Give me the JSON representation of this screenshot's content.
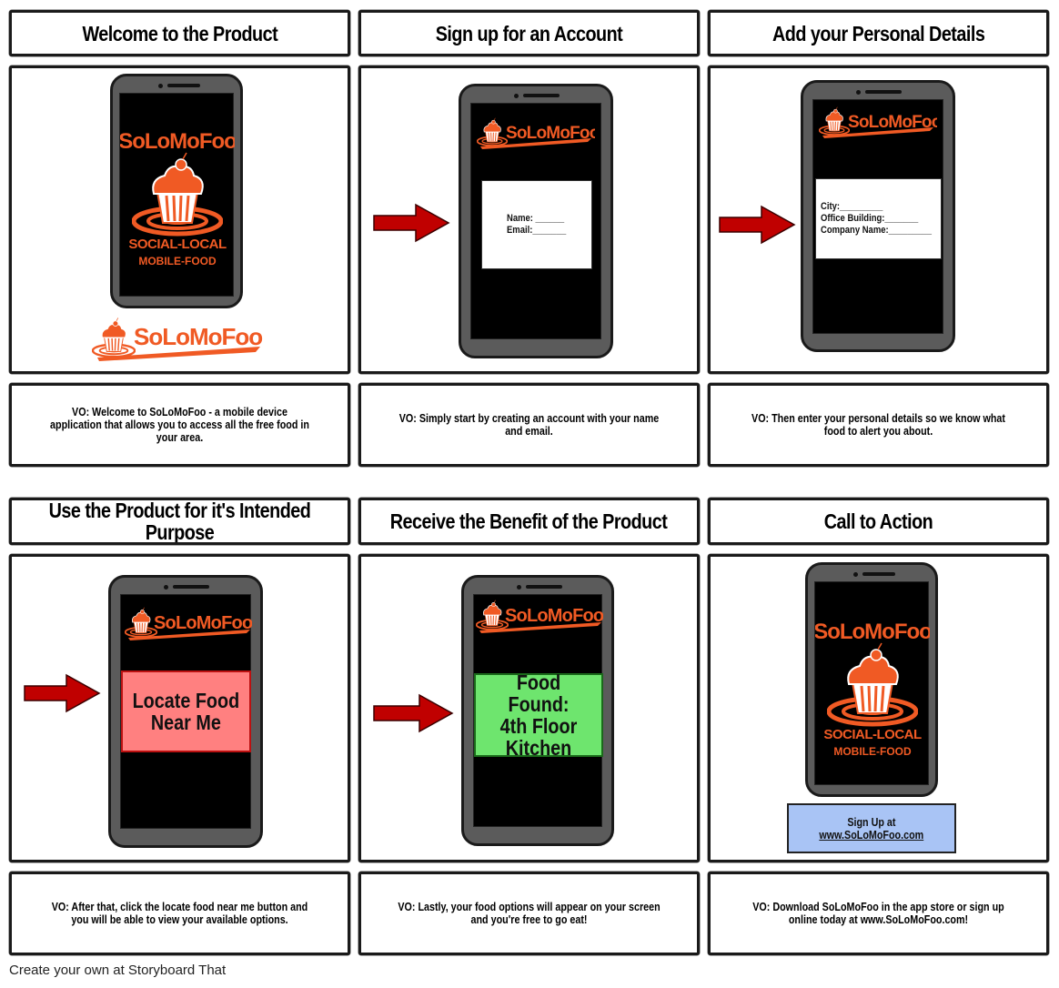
{
  "colors": {
    "brand_orange": "#f05a24",
    "arrow_red": "#c00000",
    "locate_button_fill": "#ff8080",
    "found_fill": "#6ee56e",
    "signup_fill": "#a9c4f5",
    "phone_body": "#5b5b5b"
  },
  "brand": {
    "name": "SoLoMoFoo",
    "tagline_1": "SOCIAL-LOCAL",
    "tagline_2": "MOBILE-FOOD"
  },
  "panels": [
    {
      "title": "Welcome to the Product",
      "caption": "VO: Welcome to SoLoMoFoo - a mobile device application that allows you to access all the free food in your area.",
      "scene": {
        "type": "splash",
        "icons": [
          "phone-icon",
          "cupcake-logo-icon",
          "solomofoo-wordmark-icon"
        ]
      }
    },
    {
      "title": "Sign up for an Account",
      "caption": "VO: Simply start by creating an account with your name and email.",
      "scene": {
        "type": "form",
        "form_lines": [
          "Name: ______",
          "Email:_______"
        ],
        "icons": [
          "arrow-right-icon",
          "phone-icon",
          "solomofoo-logo-icon"
        ]
      }
    },
    {
      "title": "Add your Personal Details",
      "caption": "VO: Then enter your personal details so we know what food to alert you about.",
      "scene": {
        "type": "form",
        "form_lines": [
          "City:_________",
          "Office Building:_______",
          "Company Name:_________"
        ],
        "icons": [
          "arrow-right-icon",
          "phone-icon",
          "solomofoo-logo-icon"
        ]
      }
    },
    {
      "title": "Use the Product for it's Intended Purpose",
      "caption": "VO: After that, click the locate food near me button and you will be able to view your available options.",
      "scene": {
        "type": "button",
        "button_lines": [
          "Locate Food",
          "Near Me"
        ],
        "icons": [
          "arrow-right-icon",
          "phone-icon",
          "solomofoo-logo-icon"
        ]
      }
    },
    {
      "title": "Receive the Benefit of the Product",
      "caption": "VO: Lastly, your food options will appear on your screen and you're free to go eat!",
      "scene": {
        "type": "result",
        "result_lines": [
          "Food Found:",
          "4th Floor",
          "Kitchen"
        ],
        "icons": [
          "arrow-right-icon",
          "phone-icon",
          "solomofoo-logo-icon"
        ]
      }
    },
    {
      "title": "Call to Action",
      "caption": "VO: Download SoLoMoFoo in the app store or sign up online today at www.SoLoMoFoo.com!",
      "scene": {
        "type": "cta",
        "signup_line_1": "Sign Up at",
        "signup_link": "www.SoLoMoFoo.com",
        "icons": [
          "phone-icon",
          "cupcake-logo-icon"
        ]
      }
    }
  ],
  "footer": {
    "text": "Create your own at Storyboard That"
  }
}
